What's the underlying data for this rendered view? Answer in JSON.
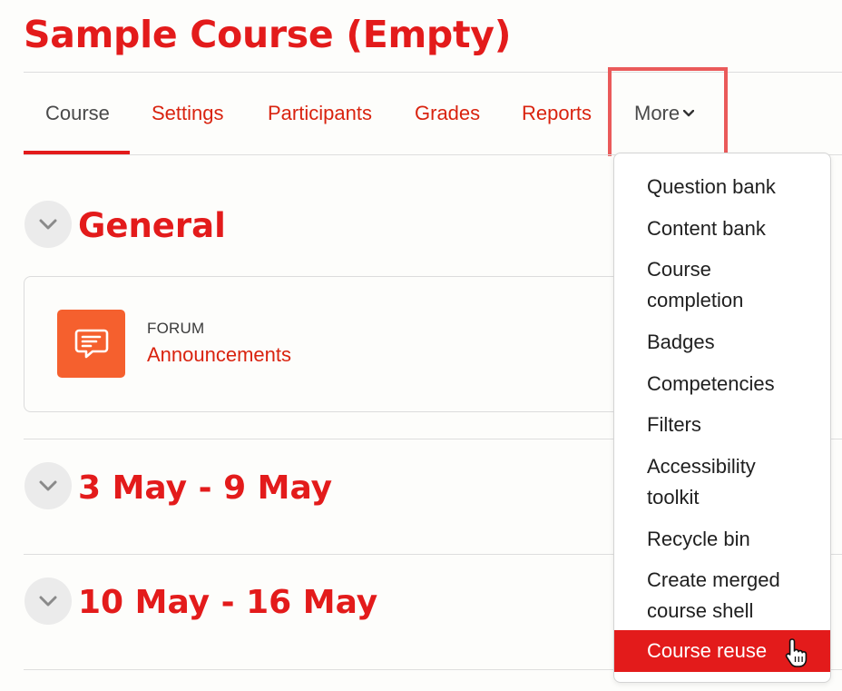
{
  "page_title": "Sample Course (Empty)",
  "tabs": {
    "course": "Course",
    "settings": "Settings",
    "participants": "Participants",
    "grades": "Grades",
    "reports": "Reports",
    "more": "More"
  },
  "sections": {
    "general": "General",
    "week1": "3 May - 9 May",
    "week2": "10 May - 16 May"
  },
  "activity": {
    "type": "FORUM",
    "name": "Announcements"
  },
  "more_menu": {
    "items": [
      "Question bank",
      "Content bank",
      "Course completion",
      "Badges",
      "Competencies",
      "Filters",
      "Accessibility toolkit",
      "Recycle bin",
      "Create merged course shell",
      "Course reuse"
    ],
    "selected": "Course reuse"
  },
  "colors": {
    "accent": "#e31b1b",
    "forum_icon_bg": "#f5602e",
    "highlight_border": "#ea5a5a"
  }
}
